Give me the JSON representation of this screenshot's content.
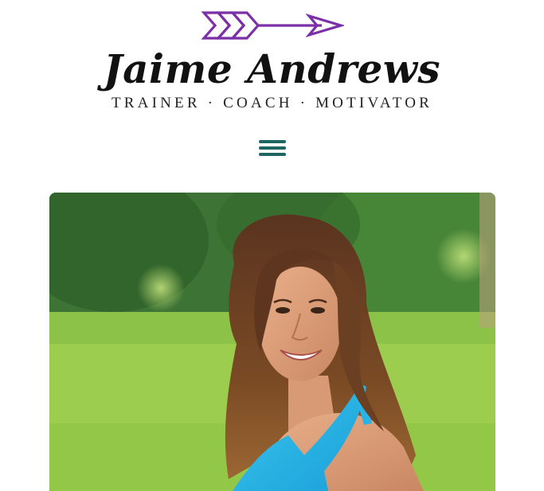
{
  "header": {
    "site_name": "Jaime Andrews",
    "tagline": "TRAINER · COACH · MOTIVATOR",
    "logo_icon": "arrow-icon",
    "brand_color": "#7b2fa8"
  },
  "nav": {
    "menu_icon": "hamburger-menu-icon",
    "menu_color": "#1e6661"
  },
  "hero": {
    "image_subject": "portrait-photo"
  }
}
